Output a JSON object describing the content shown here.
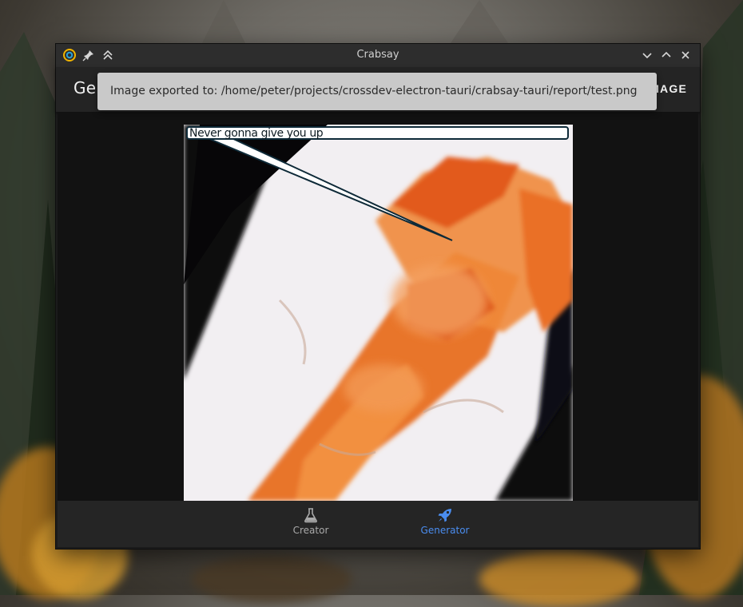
{
  "window": {
    "title": "Crabsay",
    "icons": [
      "app-logo-icon",
      "pin-icon",
      "keep-above-icon",
      "minimize-icon",
      "maximize-icon",
      "close-icon"
    ]
  },
  "appbar": {
    "title": "Generator",
    "action_label": "SAVE IMAGE"
  },
  "toast": {
    "message": "Image exported to: /home/peter/projects/crossdev-electron-tauri/crabsay-tauri/report/test.png"
  },
  "canvas": {
    "speech_text": "Never gonna give you up"
  },
  "bottom_nav": {
    "items": [
      {
        "label": "Creator",
        "icon": "flask-icon",
        "active": false
      },
      {
        "label": "Generator",
        "icon": "rocket-icon",
        "active": true
      }
    ]
  },
  "colors": {
    "accent": "#4a8df0",
    "toast_bg": "#c9c9c9",
    "window_bg": "#1b1b1b"
  }
}
